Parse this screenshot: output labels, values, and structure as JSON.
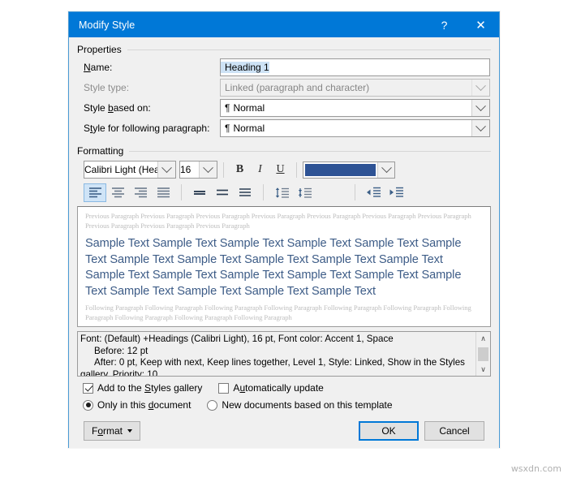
{
  "window": {
    "title": "Modify Style",
    "help_icon": "?",
    "close_icon": "✕"
  },
  "properties": {
    "group_label": "Properties",
    "name_label_pre": "N",
    "name_label_post": "ame:",
    "name_value": "Heading 1",
    "style_type_label": "Style type:",
    "style_type_value": "Linked (paragraph and character)",
    "based_on_label_pre": "Style ",
    "based_on_label_mid": "b",
    "based_on_label_post": "ased on:",
    "based_on_value": "Normal",
    "based_on_marker": "¶",
    "following_label_pre": "S",
    "following_label_mid": "t",
    "following_label_post": "yle for following paragraph:",
    "following_value": "Normal",
    "following_marker": "¶"
  },
  "formatting": {
    "group_label": "Formatting",
    "font_name": "Calibri Light (Head",
    "font_size": "16",
    "bold_label": "B",
    "italic_label": "I",
    "underline_label": "U",
    "font_color_hex": "#2e5395",
    "alignment": {
      "selected": "left",
      "options": [
        "align-left",
        "align-center",
        "align-right",
        "align-justify"
      ]
    },
    "line_spacing": [
      "line-spacing-single",
      "line-spacing-1-5",
      "line-spacing-double"
    ],
    "paragraph_spacing": [
      "increase-paragraph-spacing",
      "decrease-paragraph-spacing"
    ],
    "indent": [
      "decrease-indent",
      "increase-indent"
    ]
  },
  "preview": {
    "previous_paragraph": "Previous Paragraph Previous Paragraph Previous Paragraph Previous Paragraph Previous Paragraph Previous Paragraph Previous Paragraph Previous Paragraph Previous Paragraph Previous Paragraph",
    "sample_text": "Sample Text Sample Text Sample Text Sample Text Sample Text Sample Text Sample Text Sample Text Sample Text Sample Text Sample Text Sample Text Sample Text Sample Text Sample Text Sample Text Sample Text Sample Text Sample Text Sample Text Sample Text",
    "following_paragraph": "Following Paragraph Following Paragraph Following Paragraph Following Paragraph Following Paragraph Following Paragraph Following Paragraph Following Paragraph Following Paragraph Following Paragraph",
    "sample_color_hex": "#3d5c87",
    "ghost_color_hex": "#bdbdbd"
  },
  "description": {
    "line1": "Font: (Default) +Headings (Calibri Light), 16 pt, Font color: Accent 1, Space",
    "line2": "Before:  12 pt",
    "line3": "After:  0 pt, Keep with next, Keep lines together, Level 1, Style: Linked, Show in the Styles",
    "line4": "gallery, Priority: 10",
    "scroll_up_icon": "∧",
    "scroll_down_icon": "∨"
  },
  "options": {
    "add_to_gallery_pre": "Add to the ",
    "add_to_gallery_mid": "S",
    "add_to_gallery_post": "tyles gallery",
    "add_to_gallery_checked": true,
    "auto_update_pre": "A",
    "auto_update_mid": "u",
    "auto_update_post": "tomatically update",
    "auto_update_checked": false,
    "only_this_doc_pre": "Only in this ",
    "only_this_doc_mid": "d",
    "only_this_doc_post": "ocument",
    "only_this_doc_selected": true,
    "new_docs_label": "New documents based on this template",
    "new_docs_selected": false
  },
  "footer": {
    "format_pre": "F",
    "format_mid": "o",
    "format_post": "rmat",
    "ok_label": "OK",
    "cancel_label": "Cancel"
  },
  "watermark": {
    "text": "wsxdn.com"
  },
  "theme": {
    "titlebar_bg": "#0078d7",
    "dialog_bg": "#f0f0f0",
    "accent_focus": "#0078d7",
    "selection_bg": "#cde2f5"
  }
}
